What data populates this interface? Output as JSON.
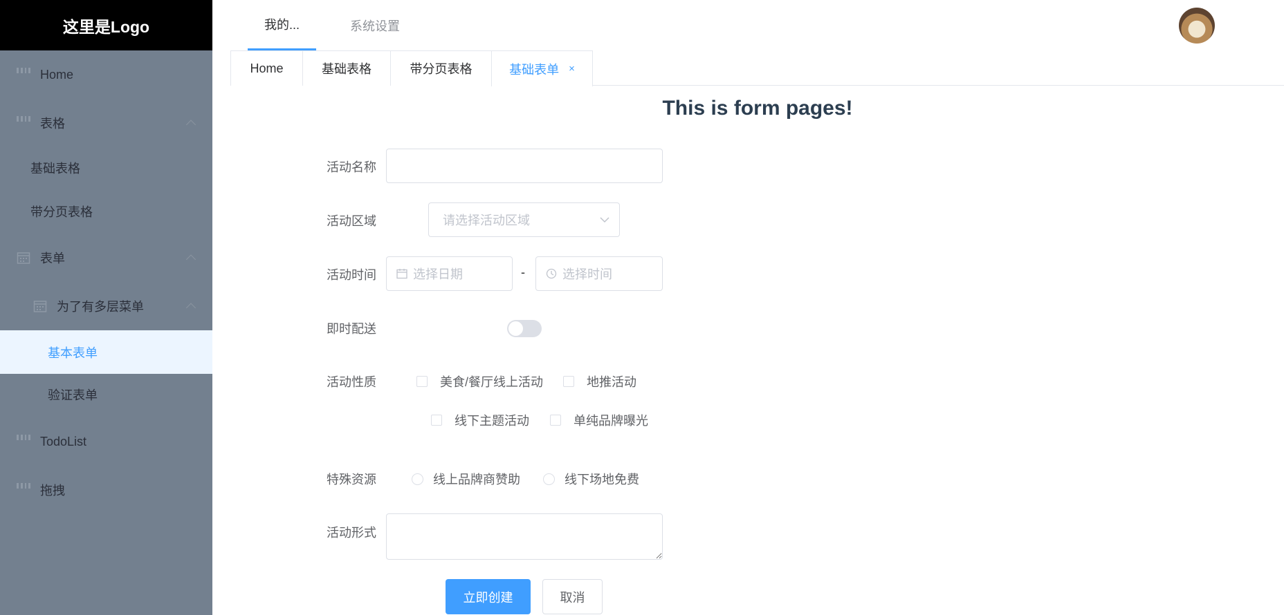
{
  "sidebar": {
    "logo": "这里是Logo",
    "items": [
      {
        "label": "Home",
        "icon": "grid-icon"
      },
      {
        "label": "表格",
        "icon": "grid-icon",
        "expanded": true
      },
      {
        "label": "基础表格"
      },
      {
        "label": "带分页表格"
      },
      {
        "label": "表单",
        "icon": "calendar-icon",
        "expanded": true
      },
      {
        "label": "为了有多层菜单",
        "icon": "calendar-icon",
        "expanded": true
      },
      {
        "label": "基本表单",
        "active": true
      },
      {
        "label": "验证表单"
      },
      {
        "label": "TodoList",
        "icon": "grid-icon"
      },
      {
        "label": "拖拽",
        "icon": "grid-icon"
      }
    ]
  },
  "topnav": {
    "tabs": [
      {
        "label": "我的...",
        "active": true
      },
      {
        "label": "系统设置"
      }
    ]
  },
  "tabs": [
    {
      "label": "Home"
    },
    {
      "label": "基础表格"
    },
    {
      "label": "带分页表格"
    },
    {
      "label": "基础表单",
      "active": true,
      "closable": true
    }
  ],
  "tab_close": "×",
  "page": {
    "title": "This is form pages!"
  },
  "form": {
    "name_label": "活动名称",
    "name_value": "",
    "region_label": "活动区域",
    "region_placeholder": "请选择活动区域",
    "time_label": "活动时间",
    "date_placeholder": "选择日期",
    "time_placeholder": "选择时间",
    "time_sep": "-",
    "delivery_label": "即时配送",
    "delivery_on": false,
    "type_label": "活动性质",
    "types": [
      "美食/餐厅线上活动",
      "地推活动",
      "线下主题活动",
      "单纯品牌曝光"
    ],
    "resource_label": "特殊资源",
    "resources": [
      "线上品牌商赞助",
      "线下场地免费"
    ],
    "desc_label": "活动形式",
    "desc_value": "",
    "submit_label": "立即创建",
    "cancel_label": "取消"
  },
  "colors": {
    "accent": "#409eff",
    "sidebar": "#73808f",
    "logo_bg": "#000000"
  }
}
